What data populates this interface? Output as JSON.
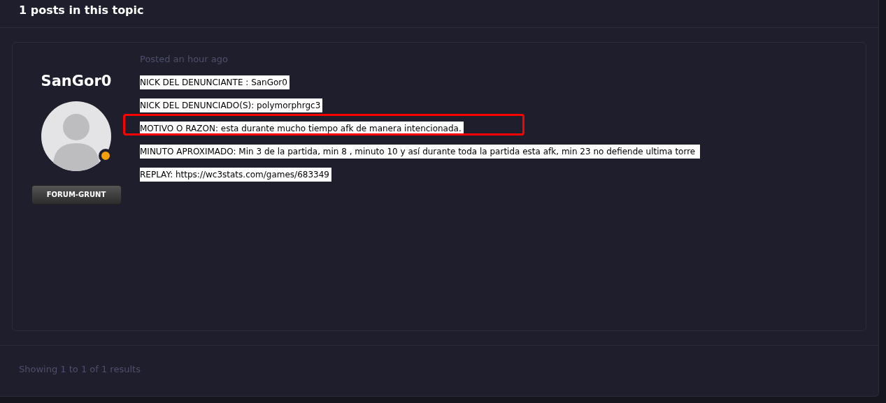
{
  "header": {
    "title": "1 posts in this topic"
  },
  "post": {
    "author": "SanGor0",
    "presence_dot": true,
    "rank": "FORUM-GRUNT",
    "posted": "Posted an hour ago",
    "lines": [
      {
        "text": "NICK DEL DENUNCIANTE : SanGor0",
        "highlighted": false
      },
      {
        "text": "NICK DEL DENUNCIADO(S): polymorphrgc3",
        "highlighted": false
      },
      {
        "text": "MOTIVO O RAZON: esta durante mucho tiempo afk de manera intencionada.",
        "highlighted": true
      },
      {
        "text": "MINUTO APROXIMADO: Min 3 de la partida, min 8 , minuto 10 y así durante toda la partida esta afk, min 23 no defiende ultima torre ",
        "highlighted": false
      },
      {
        "text": "REPLAY: https://wc3stats.com/games/683349",
        "highlighted": false
      }
    ]
  },
  "footer": {
    "results": "Showing 1 to 1 of 1 results"
  }
}
